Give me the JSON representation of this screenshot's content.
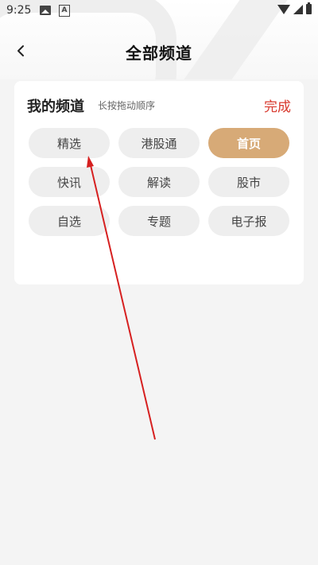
{
  "status_bar": {
    "time": "9:25",
    "a_label": "A"
  },
  "nav": {
    "title": "全部频道"
  },
  "card": {
    "title": "我的频道",
    "hint": "长按拖动顺序",
    "done_label": "完成",
    "channels": [
      {
        "label": "精选",
        "active": false
      },
      {
        "label": "港股通",
        "active": false
      },
      {
        "label": "首页",
        "active": true
      },
      {
        "label": "快讯",
        "active": false
      },
      {
        "label": "解读",
        "active": false
      },
      {
        "label": "股市",
        "active": false
      },
      {
        "label": "自选",
        "active": false
      },
      {
        "label": "专题",
        "active": false
      },
      {
        "label": "电子报",
        "active": false
      }
    ]
  },
  "colors": {
    "accent": "#d7aa77",
    "done": "#d8382c",
    "annotation": "#d62020"
  }
}
